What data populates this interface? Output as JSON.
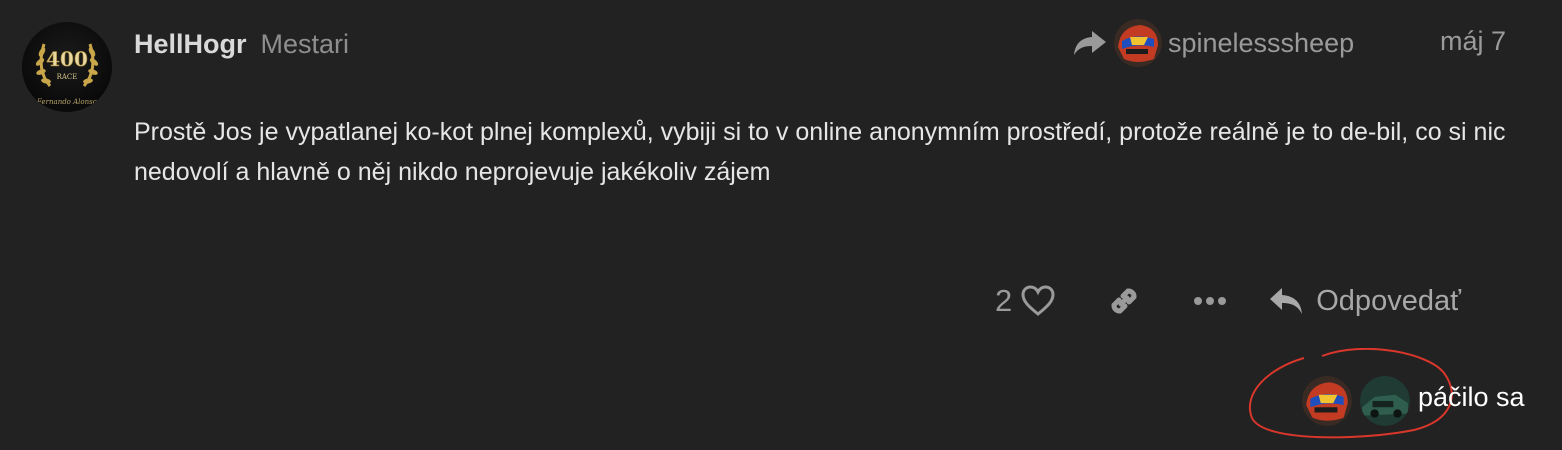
{
  "post": {
    "author": {
      "username": "HellHogr",
      "title": "Mestari",
      "avatar_icon": "laurel-400-race-avatar",
      "avatar_text": {
        "number": "400",
        "caption": "RACE",
        "signature": "Fernando Alonso"
      }
    },
    "reply_to": {
      "icon": "share-arrow-icon",
      "username": "spinelesssheep",
      "avatar_icon": "helmet-avatar"
    },
    "date": "máj 7",
    "body": "Prostě Jos je vypatlanej ko-kot plnej komplexů, vybiji si to v online anonymním prostředí, protože reálně je to de-bil, co si nic nedovolí a hlavně o něj nikdo neprojevuje jakékoliv zájem",
    "actions": {
      "like_count": "2",
      "like_icon": "heart-icon",
      "link_icon": "link-icon",
      "more_icon": "ellipsis-icon",
      "reply_icon": "reply-arrow-icon",
      "reply_label": "Odpovedať"
    },
    "likers": {
      "avatars": [
        "helmet-avatar",
        "green-car-avatar"
      ],
      "label": "páčilo sa"
    }
  },
  "colors": {
    "background": "#222222",
    "text": "#e6e6e6",
    "muted": "#9a9a9a",
    "annotation": "#d9372b"
  }
}
